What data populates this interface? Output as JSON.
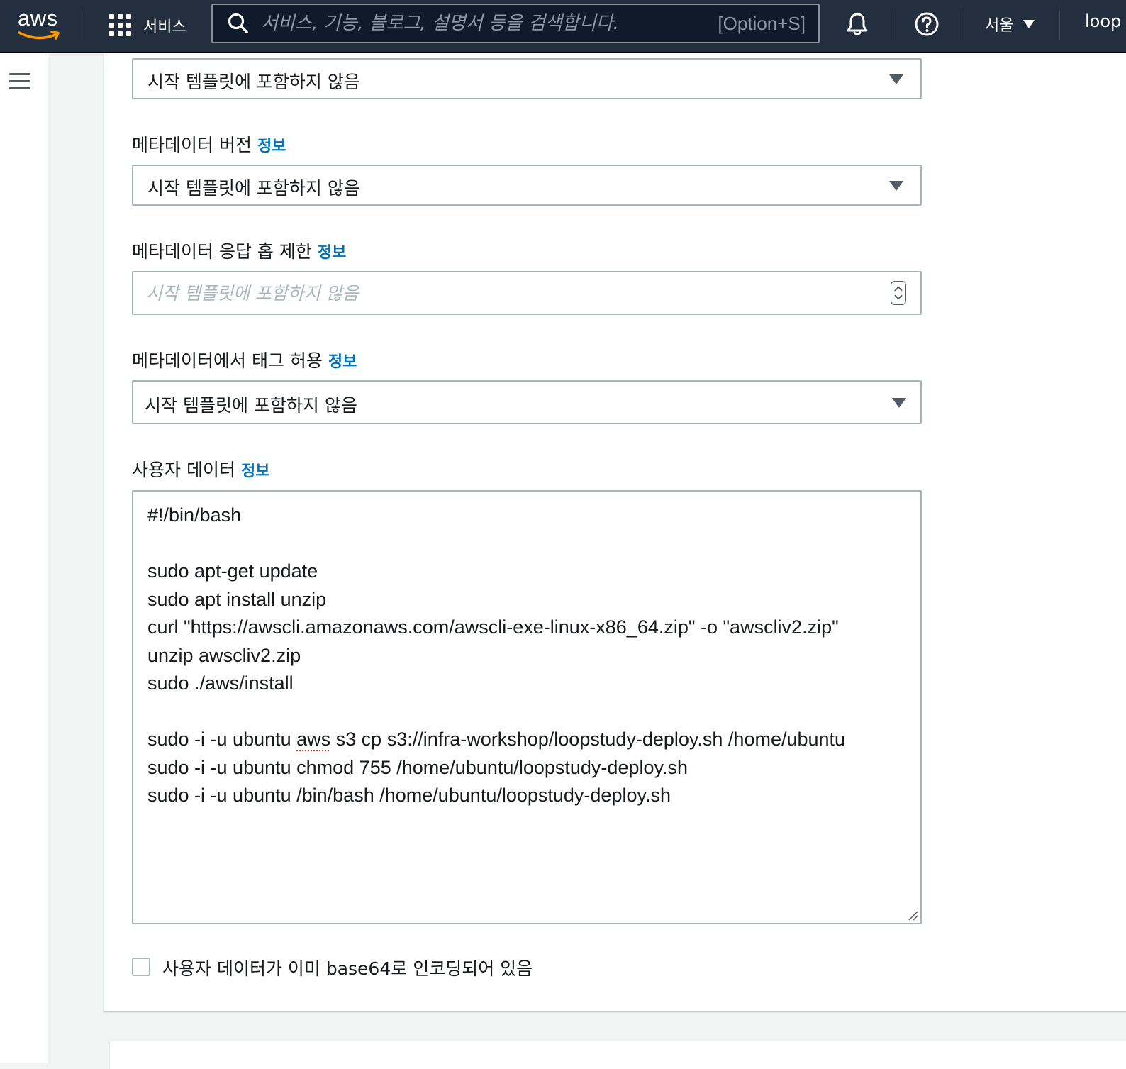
{
  "colors": {
    "nav_bg": "#232f3e",
    "link": "#0073bb",
    "border": "#aab7b8",
    "text": "#16191f"
  },
  "nav": {
    "logo_text": "aws",
    "services_label": "서비스",
    "search_placeholder": "서비스, 기능, 블로그, 설명서 등을 검색합니다.",
    "search_shortcut": "[Option+S]",
    "region": "서울",
    "account": "loop",
    "icons": [
      "grid-icon",
      "search-icon",
      "bell-icon",
      "help-icon",
      "chevron-down-icon"
    ]
  },
  "sidebar": {
    "icon": "hamburger-icon"
  },
  "form": {
    "top_select_value": "시작 템플릿에 포함하지 않음",
    "metadata_version": {
      "label": "메타데이터 버전",
      "info": "정보",
      "value": "시작 템플릿에 포함하지 않음"
    },
    "metadata_hop_limit": {
      "label": "메타데이터 응답 홉 제한",
      "info": "정보",
      "placeholder": "시작 템플릿에 포함하지 않음"
    },
    "metadata_tags": {
      "label": "메타데이터에서 태그 허용",
      "info": "정보",
      "value": "시작 템플릿에 포함하지 않음"
    },
    "user_data": {
      "label": "사용자 데이터",
      "info": "정보",
      "lines": [
        "#!/bin/bash",
        "",
        "sudo apt-get update",
        "sudo apt install unzip",
        "curl \"https://awscli.amazonaws.com/awscli-exe-linux-x86_64.zip\" -o \"awscliv2.zip\"",
        "unzip awscliv2.zip",
        "sudo ./aws/install",
        "",
        "sudo -i -u ubuntu aws s3 cp s3://infra-workshop/loopstudy-deploy.sh /home/ubuntu",
        "sudo -i -u ubuntu chmod 755 /home/ubuntu/loopstudy-deploy.sh",
        "sudo -i -u ubuntu /bin/bash /home/ubuntu/loopstudy-deploy.sh"
      ]
    },
    "base64_checkbox": {
      "label": "사용자 데이터가 이미 base64로 인코딩되어 있음",
      "checked": false
    }
  }
}
